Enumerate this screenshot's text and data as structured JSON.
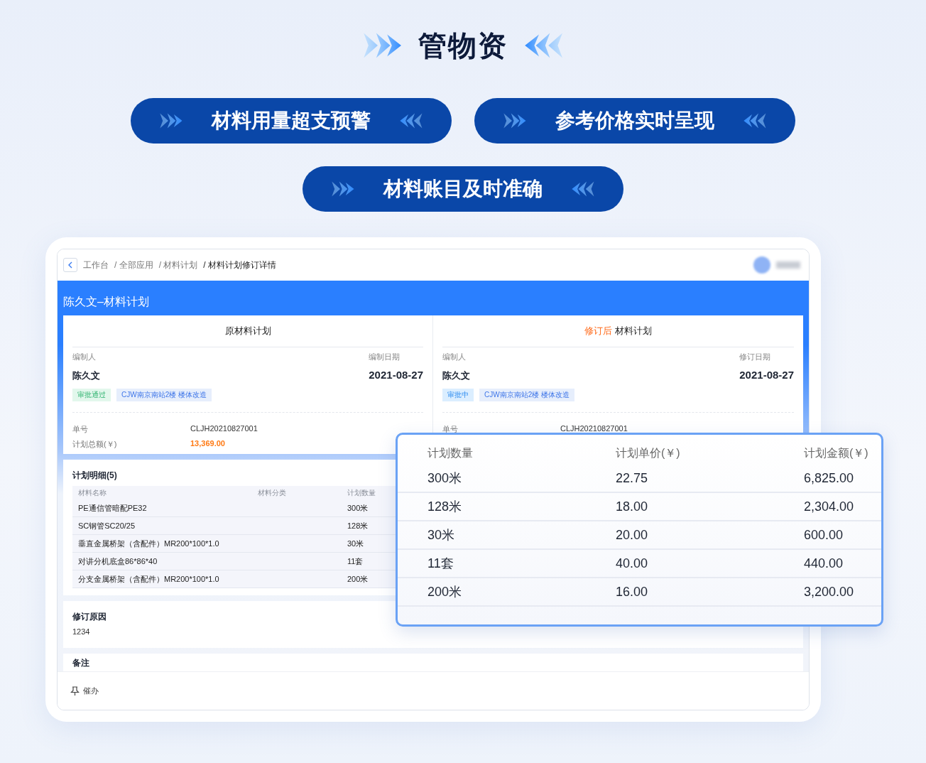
{
  "title": "管物资",
  "features": [
    "材料用量超支预警",
    "参考价格实时呈现",
    "材料账目及时准确"
  ],
  "screen": {
    "breadcrumb": [
      {
        "label": "工作台",
        "current": false
      },
      {
        "label": "/ 全部应用",
        "current": false
      },
      {
        "label": "/ 材料计划",
        "current": false
      },
      {
        "label": "/ 材料计划修订详情",
        "current": true
      }
    ],
    "plan_title": "陈久文–材料计划",
    "plans": [
      {
        "heading": "原材料计划",
        "editor_label": "编制人",
        "editor": "陈久文",
        "date_label": "编制日期",
        "date": "2021-08-27",
        "tags": [
          {
            "label": "审批通过",
            "kind": "approved"
          },
          {
            "label": "CJW南京南站2楼 楼体改造",
            "kind": "project"
          }
        ],
        "fields": [
          {
            "label": "单号",
            "value": "CLJH20210827001",
            "kind": "plain"
          },
          {
            "label": "计划总额(￥)",
            "value": "13,369.00",
            "kind": "amount"
          }
        ]
      },
      {
        "heading_highlight": "修订后",
        "heading": "材料计划",
        "editor_label": "编制人",
        "editor": "陈久文",
        "date_label": "修订日期",
        "date": "2021-08-27",
        "tags": [
          {
            "label": "审批中",
            "kind": "pending"
          },
          {
            "label": "CJW南京南站2楼 楼体改造",
            "kind": "project"
          }
        ],
        "fields": [
          {
            "label": "单号",
            "value": "CLJH20210827001",
            "kind": "plain"
          }
        ]
      }
    ],
    "details": {
      "title": "计划明细(5)",
      "columns": [
        "材料名称",
        "材料分类",
        "计划数量"
      ],
      "rows": [
        {
          "name": "PE通信管暗配PE32",
          "quantity": "300米"
        },
        {
          "name": "SC钢管SC20/25",
          "quantity": "128米"
        },
        {
          "name": "垂直金属桥架（含配件）MR200*100*1.0",
          "quantity": "30米"
        },
        {
          "name": "对讲分机底盒86*86*40",
          "quantity": "11套"
        },
        {
          "name": "分支金属桥架（含配件）MR200*100*1.0",
          "quantity": "200米"
        }
      ]
    },
    "revision_reason": {
      "title": "修订原因",
      "text": "1234"
    },
    "remarks": {
      "title": "备注"
    },
    "footer": {
      "action": "催办"
    }
  },
  "popup": {
    "columns": [
      "计划数量",
      "计划单价(￥)",
      "计划金额(￥)"
    ],
    "rows": [
      {
        "quantity": "300米",
        "unit_price": "22.75",
        "amount": "6,825.00"
      },
      {
        "quantity": "128米",
        "unit_price": "18.00",
        "amount": "2,304.00"
      },
      {
        "quantity": "30米",
        "unit_price": "20.00",
        "amount": "600.00"
      },
      {
        "quantity": "11套",
        "unit_price": "40.00",
        "amount": "440.00"
      },
      {
        "quantity": "200米",
        "unit_price": "16.00",
        "amount": "3,200.00"
      }
    ]
  }
}
